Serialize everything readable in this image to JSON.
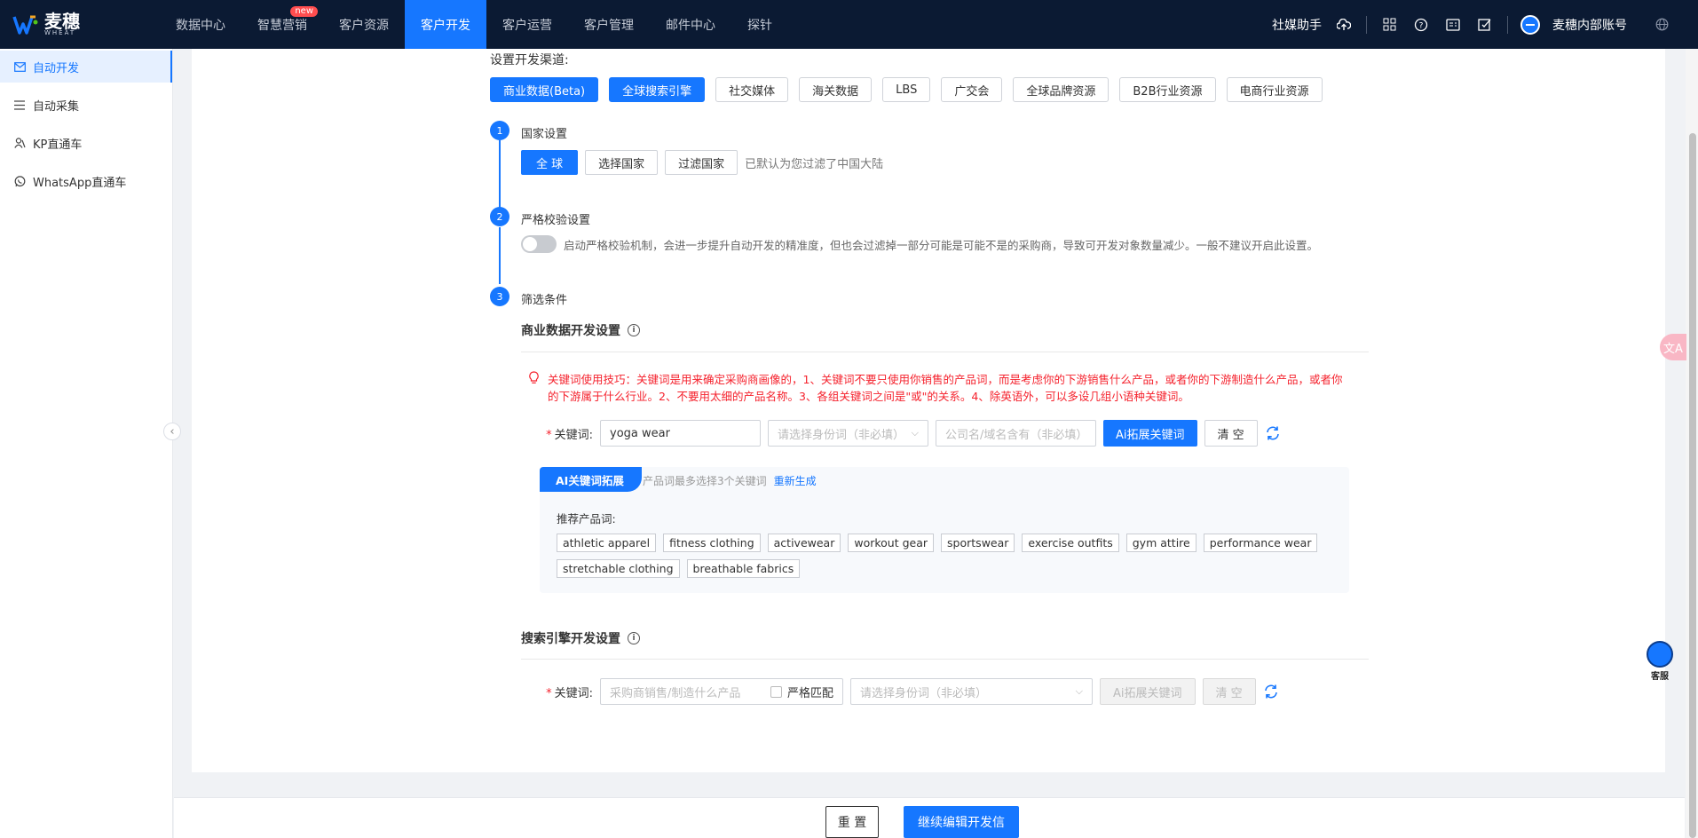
{
  "brand": {
    "name": "麦穗",
    "sub": "WHEAT"
  },
  "nav": [
    {
      "label": "数据中心",
      "active": false
    },
    {
      "label": "智慧营销",
      "active": false,
      "badge": "new"
    },
    {
      "label": "客户资源",
      "active": false
    },
    {
      "label": "客户开发",
      "active": true
    },
    {
      "label": "客户运营",
      "active": false
    },
    {
      "label": "客户管理",
      "active": false
    },
    {
      "label": "邮件中心",
      "active": false
    },
    {
      "label": "探针",
      "active": false
    }
  ],
  "topright": {
    "social": "社媒助手",
    "account": "麦穗内部账号"
  },
  "sidebar": [
    {
      "label": "自动开发",
      "icon": "mail-icon"
    },
    {
      "label": "自动采集",
      "icon": "list-icon"
    },
    {
      "label": "KP直通车",
      "icon": "people-icon"
    },
    {
      "label": "WhatsApp直通车",
      "icon": "whatsapp-icon"
    }
  ],
  "channels": {
    "title": "设置开发渠道:",
    "items": [
      "商业数据(Beta)",
      "全球搜索引擎",
      "社交媒体",
      "海关数据",
      "LBS",
      "广交会",
      "全球品牌资源",
      "B2B行业资源",
      "电商行业资源"
    ]
  },
  "steps": {
    "s1": {
      "num": "1",
      "title": "国家设置",
      "opts": [
        "全 球",
        "选择国家",
        "过滤国家"
      ],
      "hint": "已默认为您过滤了中国大陆"
    },
    "s2": {
      "num": "2",
      "title": "严格校验设置",
      "desc": "启动严格校验机制，会进一步提升自动开发的精准度，但也会过滤掉一部分可能是可能不是的采购商，导致可开发对象数量减少。一般不建议开启此设置。"
    },
    "s3": {
      "num": "3",
      "title": "筛选条件"
    }
  },
  "biz": {
    "title": "商业数据开发设置",
    "tip": "关键词使用技巧：关键词是用来确定采购商画像的，1、关键词不要只使用你销售的产品词，而是考虑你的下游销售什么产品，或者你的下游制造什么产品，或者你的下游属于什么行业。2、不要用太细的产品名称。3、各组关键词之间是\"或\"的关系。4、除英语外，可以多设几组小语种关键词。",
    "kw_label": "关键词:",
    "kw_value": "yoga wear",
    "identity_ph": "请选择身份词（非必填）",
    "company_ph": "公司名/域名含有（非必填）",
    "ai_btn": "Ai拓展关键词",
    "clear_btn": "清 空"
  },
  "ai": {
    "tab": "AI关键词拓展",
    "hint": "产品词最多选择3个关键词",
    "regen": "重新生成",
    "reco_label": "推荐产品词:",
    "tags": [
      "athletic apparel",
      "fitness clothing",
      "activewear",
      "workout gear",
      "sportswear",
      "exercise outfits",
      "gym attire",
      "performance wear",
      "stretchable clothing",
      "breathable fabrics"
    ]
  },
  "search": {
    "title": "搜索引擎开发设置",
    "kw_label": "关键词:",
    "kw_ph": "采购商销售/制造什么产品",
    "strict": "严格匹配",
    "identity_ph": "请选择身份词（非必填）",
    "ai_btn": "Ai拓展关键词",
    "clear_btn": "清 空"
  },
  "footer": {
    "reset": "重 置",
    "continue": "继续编辑开发信"
  },
  "float": {
    "translate": "文A",
    "service": "客服"
  },
  "colors": {
    "primary": "#1677ff",
    "topbar": "#0b1a33",
    "danger": "#f5222d"
  }
}
